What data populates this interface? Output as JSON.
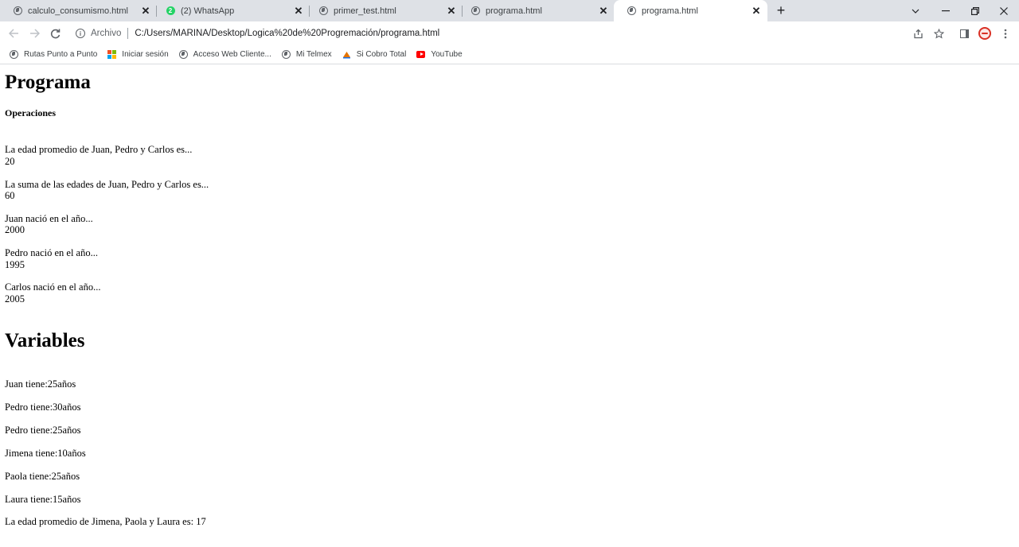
{
  "tabs": [
    {
      "title": "calculo_consumismo.html",
      "icon": "globe-icon"
    },
    {
      "title": "(2) WhatsApp",
      "icon": "whatsapp-icon",
      "badge": "2"
    },
    {
      "title": "primer_test.html",
      "icon": "globe-icon"
    },
    {
      "title": "programa.html",
      "icon": "globe-icon"
    },
    {
      "title": "programa.html",
      "icon": "globe-icon",
      "active": true
    }
  ],
  "omnibox": {
    "scheme_label": "Archivo",
    "url": "C:/Users/MARINA/Desktop/Logica%20de%20Progremación/programa.html"
  },
  "bookmarks": [
    {
      "label": "Rutas Punto a Punto",
      "icon": "globe-icon"
    },
    {
      "label": "Iniciar sesión",
      "icon": "microsoft-icon"
    },
    {
      "label": "Acceso Web Cliente...",
      "icon": "globe-icon"
    },
    {
      "label": "Mi Telmex",
      "icon": "globe-icon"
    },
    {
      "label": "Si Cobro Total",
      "icon": "cobro-icon"
    },
    {
      "label": "YouTube",
      "icon": "youtube-icon"
    }
  ],
  "page": {
    "title": "Programa",
    "operaciones_heading": "Operaciones",
    "operaciones": [
      {
        "label": "La edad promedio de Juan, Pedro y Carlos es...",
        "value": "20"
      },
      {
        "label": "La suma de las edades de Juan, Pedro y Carlos es...",
        "value": "60"
      },
      {
        "label": "Juan nació en el año...",
        "value": "2000"
      },
      {
        "label": "Pedro nació en el año...",
        "value": "1995"
      },
      {
        "label": "Carlos nació en el año...",
        "value": "2005"
      }
    ],
    "variables_title": "Variables",
    "variables": [
      "Juan tiene:25años",
      "Pedro tiene:30años",
      "Pedro tiene:25años",
      "Jimena tiene:10años",
      "Paola tiene:25años",
      "Laura tiene:15años",
      "La edad promedio de Jimena, Paola y Laura es: 17"
    ]
  },
  "colors": {
    "tabstrip_bg": "#dee1e6",
    "whatsapp_green": "#25d366",
    "youtube_red": "#ff0000",
    "profile_red": "#d93025"
  }
}
